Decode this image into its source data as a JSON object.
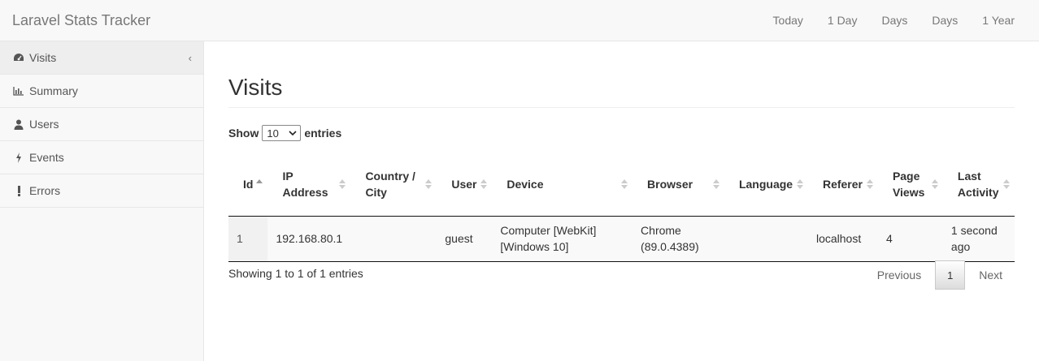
{
  "app": {
    "brand": "Laravel Stats Tracker"
  },
  "topnav": [
    {
      "label": "Today"
    },
    {
      "label": "1 Day"
    },
    {
      "label": "Days"
    },
    {
      "label": "Days"
    },
    {
      "label": "1 Year"
    }
  ],
  "sidebar": {
    "items": [
      {
        "label": "Visits",
        "icon": "dashboard-icon"
      },
      {
        "label": "Summary",
        "icon": "bar-chart-icon"
      },
      {
        "label": "Users",
        "icon": "user-icon"
      },
      {
        "label": "Events",
        "icon": "bolt-icon"
      },
      {
        "label": "Errors",
        "icon": "exclamation-icon"
      }
    ],
    "chevron": "‹"
  },
  "main": {
    "title": "Visits",
    "length": {
      "before": "Show",
      "value": "10",
      "after": "entries"
    },
    "table": {
      "columns": [
        [
          "Id"
        ],
        [
          "IP",
          "Address"
        ],
        [
          "Country /",
          "City"
        ],
        [
          "User"
        ],
        [
          "Device"
        ],
        [
          "Browser"
        ],
        [
          "Language"
        ],
        [
          "Referer"
        ],
        [
          "Page",
          "Views"
        ],
        [
          "Last",
          "Activity"
        ]
      ],
      "rows": [
        [
          [
            "1"
          ],
          [
            "192.168.80.1"
          ],
          [
            ""
          ],
          [
            "guest"
          ],
          [
            "Computer [WebKit]",
            "[Windows 10]"
          ],
          [
            "Chrome",
            "(89.0.4389)"
          ],
          [
            ""
          ],
          [
            "localhost"
          ],
          [
            "4"
          ],
          [
            "1 second",
            "ago"
          ]
        ]
      ]
    },
    "info": "Showing 1 to 1 of 1 entries",
    "pager": {
      "previous": "Previous",
      "current": "1",
      "next": "Next"
    }
  }
}
